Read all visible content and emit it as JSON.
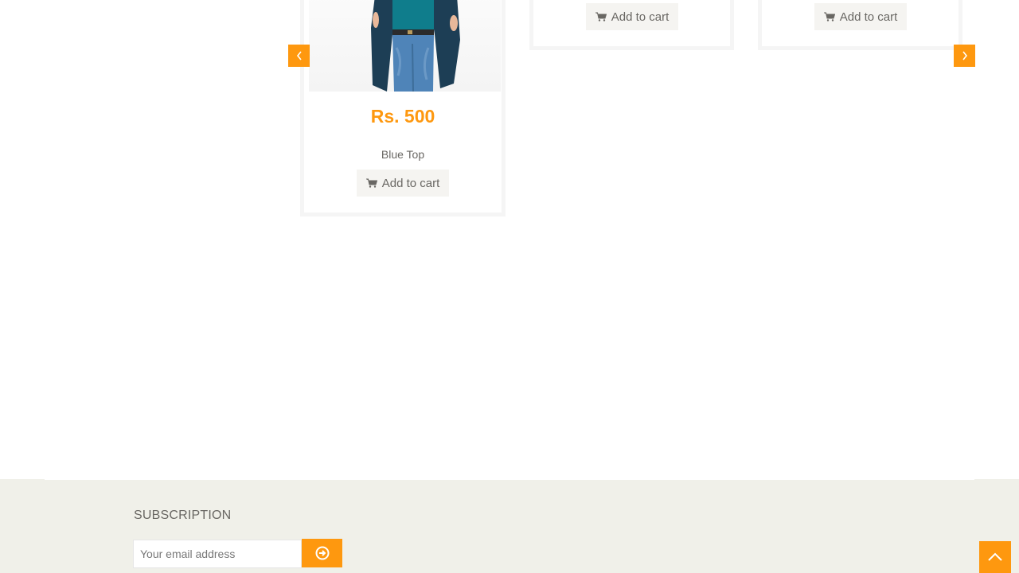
{
  "products": [
    {
      "price": "Rs. 500",
      "name": "Blue Top",
      "cta_label": "Add to cart"
    },
    {
      "cta_label": "Add to cart"
    },
    {
      "cta_label": "Add to cart"
    }
  ],
  "carousel": {
    "prev_icon": "chevron-left-icon",
    "next_icon": "chevron-right-icon"
  },
  "footer": {
    "subscription_title": "SUBSCRIPTION",
    "email_placeholder": "Your email address",
    "subscribe_icon": "arrow-circle-right-icon"
  },
  "scroll_up_icon": "chevron-up-icon",
  "colors": {
    "accent": "#FE980F",
    "button_bg": "#F5F4F1",
    "footer_bg": "#F0F0E9",
    "text": "#696763"
  }
}
